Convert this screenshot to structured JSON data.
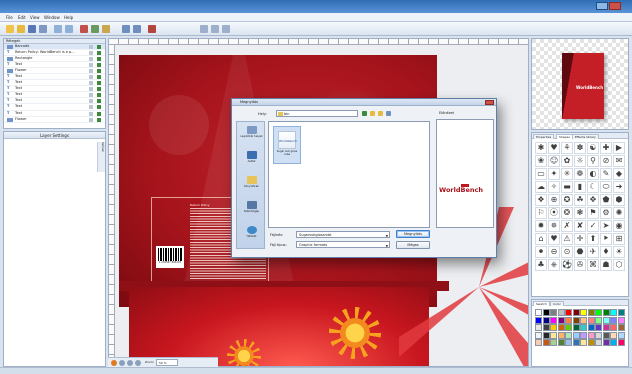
{
  "menu": {
    "items": [
      "File",
      "Edit",
      "View",
      "Window",
      "Help"
    ]
  },
  "layers": {
    "header": "Rétegek",
    "rows": [
      {
        "label": "Barcode",
        "kind": "image"
      },
      {
        "label": "Return Policy: WorldBench is a p...",
        "kind": "text"
      },
      {
        "label": "Rectangle",
        "kind": "image"
      },
      {
        "label": "Text",
        "kind": "text"
      },
      {
        "label": "Flower",
        "kind": "image"
      },
      {
        "label": "Text",
        "kind": "text"
      },
      {
        "label": "Text",
        "kind": "text"
      },
      {
        "label": "Text",
        "kind": "text"
      },
      {
        "label": "Text",
        "kind": "text"
      },
      {
        "label": "Text",
        "kind": "text"
      },
      {
        "label": "Text",
        "kind": "text"
      },
      {
        "label": "Text",
        "kind": "text"
      },
      {
        "label": "Flower",
        "kind": "image"
      }
    ]
  },
  "layer_settings": {
    "title": "Layer Settings",
    "side_tab": "Színek"
  },
  "canvas": {
    "back_title": "Return Policy",
    "barcode_number": "1 234567 890123"
  },
  "bottom_bar": {
    "zoom_label": "Zoom",
    "zoom_value": "50 %"
  },
  "preview": {
    "box_label": "WorldBench"
  },
  "shapes_panel": {
    "tabs": [
      "Properties",
      "Shapes",
      "Effects library"
    ],
    "active_tab": "Shapes",
    "glyphs": [
      "✱",
      "♥",
      "⚘",
      "✽",
      "☯",
      "✚",
      "▶",
      "❀",
      "☺",
      "✿",
      "☼",
      "⚲",
      "⊘",
      "✉",
      "▭",
      "✦",
      "✳",
      "❁",
      "◐",
      "✎",
      "◆",
      "☁",
      "✧",
      "▬",
      "▮",
      "☾",
      "⬭",
      "➜",
      "❖",
      "⊕",
      "✪",
      "☘",
      "✥",
      "⬟",
      "⬢",
      "⚐",
      "⦿",
      "❂",
      "❃",
      "⚑",
      "⚙",
      "✺",
      "✹",
      "✵",
      "✗",
      "✘",
      "✓",
      "➤",
      "◉",
      "⌂",
      "♥",
      "⚠",
      "✛",
      "⬆",
      "⯈",
      "⊞",
      "⚫",
      "⊖",
      "⊙",
      "⬣",
      "✈",
      "♦",
      "☀",
      "♣",
      "⎈",
      "⚽",
      "✇",
      "⌘",
      "☗",
      "⬡"
    ]
  },
  "colors_panel": {
    "tabs": [
      "Swatch",
      "Color"
    ],
    "swatches": [
      "#ffffff",
      "#000000",
      "#7f7f7f",
      "#c0c0c0",
      "#ff0000",
      "#800000",
      "#ffff00",
      "#808000",
      "#00ff00",
      "#008000",
      "#00ffff",
      "#008080",
      "#0000ff",
      "#000080",
      "#ff00ff",
      "#800080",
      "#ff8040",
      "#804000",
      "#ffc080",
      "#ff8080",
      "#80ff80",
      "#80ffff",
      "#8080ff",
      "#ff80ff",
      "#e6e6e6",
      "#404040",
      "#ffcc00",
      "#cc6600",
      "#66cc00",
      "#006633",
      "#33cccc",
      "#0066cc",
      "#6633cc",
      "#cc3399",
      "#ff6666",
      "#996633",
      "#f2f2f2",
      "#262626",
      "#ffe699",
      "#ffb366",
      "#b3e6b3",
      "#99ccff",
      "#c299ff",
      "#ff99cc",
      "#d9d9d9",
      "#595959",
      "#ffd9b3",
      "#b3d9ff",
      "#f8cbad",
      "#c65911",
      "#a9d08e",
      "#548235",
      "#9bc2e6",
      "#2f75b5",
      "#ffe699",
      "#bf8f00",
      "#d9d9d9",
      "#7030a0",
      "#00b0f0",
      "#ff0066"
    ]
  },
  "dialog": {
    "title": "Megnyitás",
    "look_in_label": "Hely:",
    "look_in_value": "bin",
    "preview_label": "Előnézet",
    "places": [
      "Legutóbbi helyek",
      "Asztal",
      "Könyvtárak",
      "Számítógép",
      "Hálózat"
    ],
    "file": {
      "thumb_text": "Worldbench",
      "name": "Sugar sub gloss cube"
    },
    "file_name_label": "Fájlnév:",
    "file_name_value": "Sugarsubglossmbt",
    "file_type_label": "Fájl típus:",
    "file_type_value": "Graphic formats",
    "open_button": "Megnyitás",
    "cancel_button": "Mégse",
    "preview_logo": "WorldBench"
  },
  "colors": {
    "accent": "#c0151d",
    "titlebar": "#2e6db4"
  }
}
